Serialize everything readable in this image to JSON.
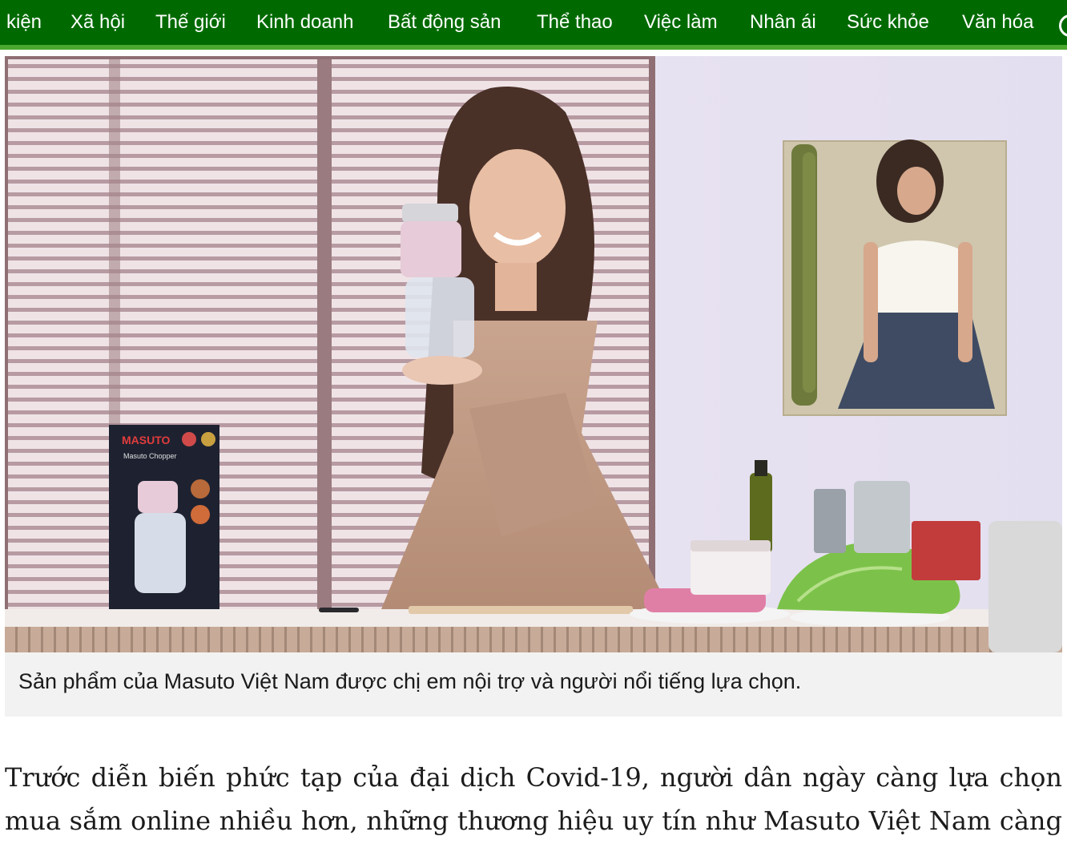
{
  "nav": {
    "items": [
      {
        "id": "su-kien",
        "label": "kiện"
      },
      {
        "id": "xa-hoi",
        "label": "Xã hội"
      },
      {
        "id": "the-gioi",
        "label": "Thế giới"
      },
      {
        "id": "kinh-doanh",
        "label": "Kinh doanh"
      },
      {
        "id": "bat-dong-san",
        "label": "Bất động sản"
      },
      {
        "id": "the-thao",
        "label": "Thể thao"
      },
      {
        "id": "viec-lam",
        "label": "Việc làm"
      },
      {
        "id": "nhan-ai",
        "label": "Nhân ái"
      },
      {
        "id": "suc-khoe",
        "label": "Sức khỏe"
      },
      {
        "id": "van-hoa",
        "label": "Văn hóa"
      }
    ],
    "colors": {
      "background": "#006a00",
      "underline": "#4aa82e",
      "text": "#ffffff"
    }
  },
  "figure": {
    "image_alt": "Người phụ nữ cầm máy xay Masuto trong căn bếp",
    "product_box": {
      "brand": "MASUTO",
      "product": "Masuto Chopper"
    },
    "caption": "Sản phẩm của Masuto Việt Nam được chị em nội trợ và người nổi tiếng lựa chọn."
  },
  "article": {
    "lines": [
      "Trước diễn biến phức tạp của đại dịch Covid-19, người dân ngày càng lựa chọn",
      "mua sắm online nhiều hơn, những thương hiệu uy tín như Masuto Việt Nam càng"
    ]
  }
}
